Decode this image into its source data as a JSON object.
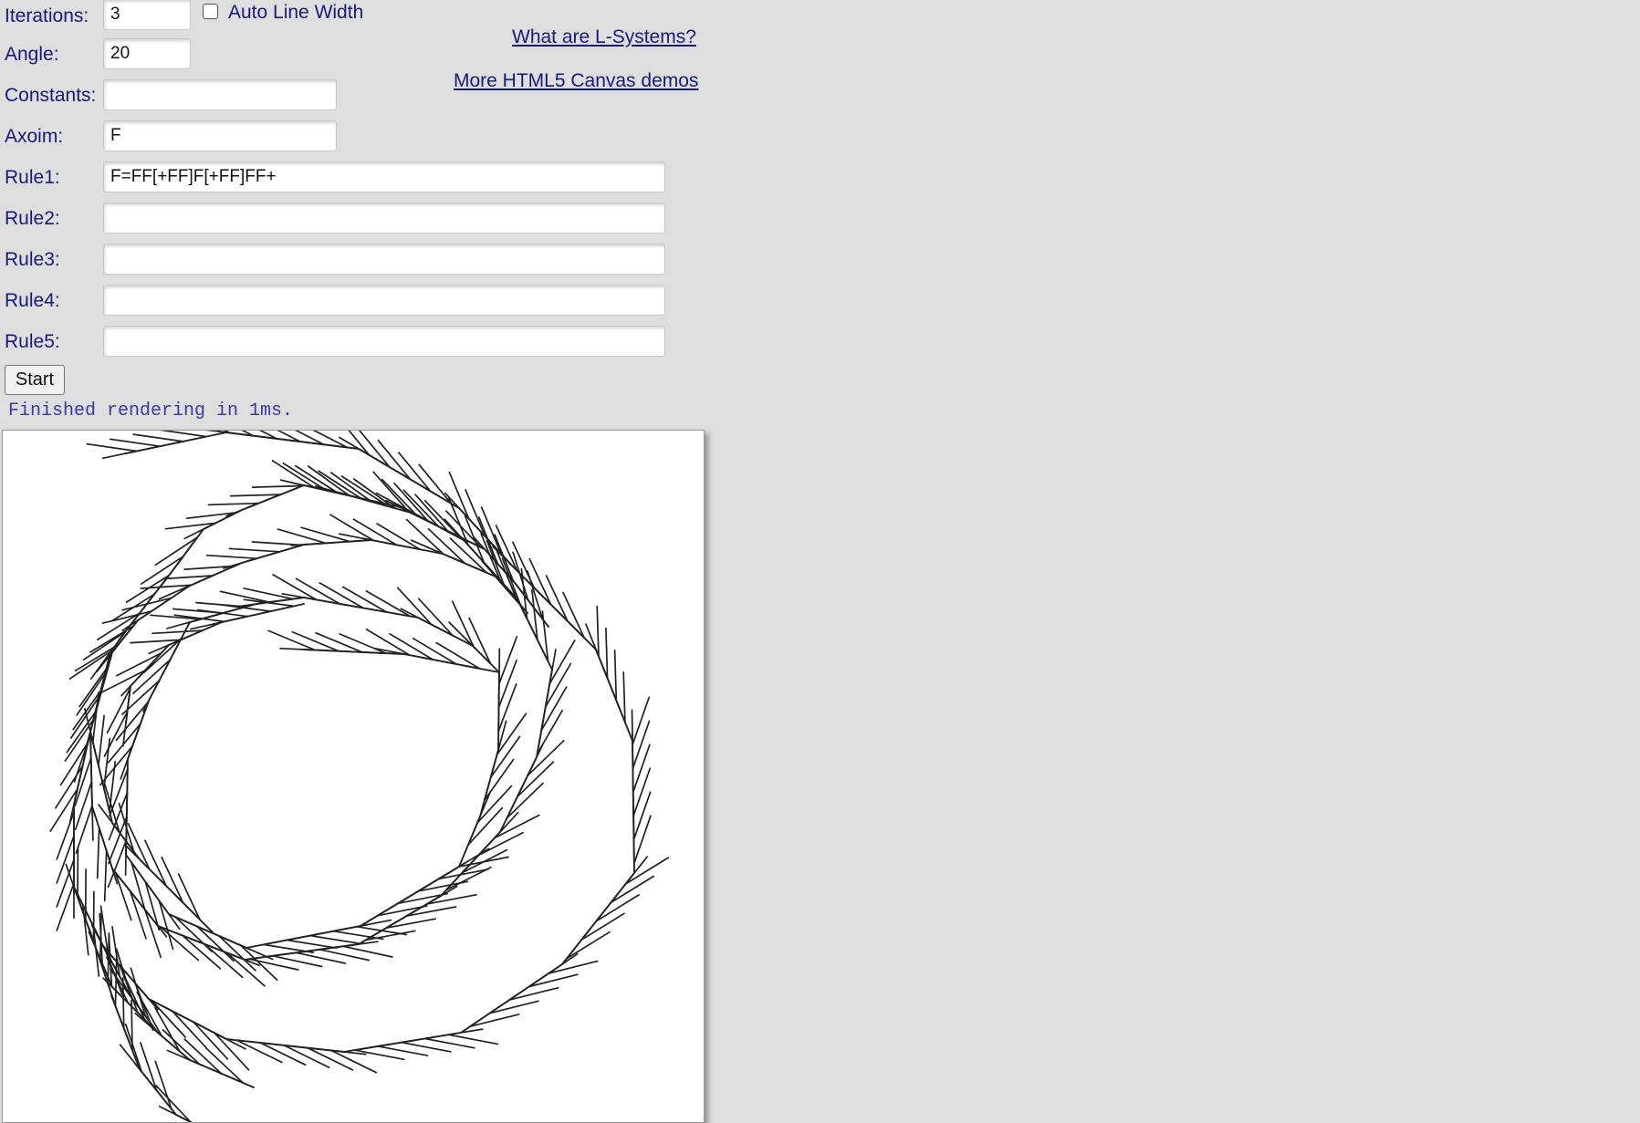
{
  "form": {
    "iterations_label": "Iterations:",
    "iterations_value": "3",
    "auto_line_width_label": "Auto Line Width",
    "auto_line_width_checked": false,
    "angle_label": "Angle:",
    "angle_value": "20",
    "constants_label": "Constants:",
    "constants_value": "",
    "axiom_label": "Axoim:",
    "axiom_value": "F",
    "rules": [
      {
        "label": "Rule1:",
        "value": "F=FF[+FF]F[+FF]FF+"
      },
      {
        "label": "Rule2:",
        "value": ""
      },
      {
        "label": "Rule3:",
        "value": ""
      },
      {
        "label": "Rule4:",
        "value": ""
      },
      {
        "label": "Rule5:",
        "value": ""
      }
    ],
    "start_label": "Start"
  },
  "links": {
    "what_are": "What are L-Systems?",
    "more_demos": "More HTML5 Canvas demos"
  },
  "status": "Finished rendering in 1ms.",
  "colors": {
    "background": "#dedede",
    "label": "#1a1a78",
    "status": "#3a3aa0",
    "stroke": "#222222"
  },
  "icons": {
    "checkbox": "checkbox-unchecked-icon"
  }
}
